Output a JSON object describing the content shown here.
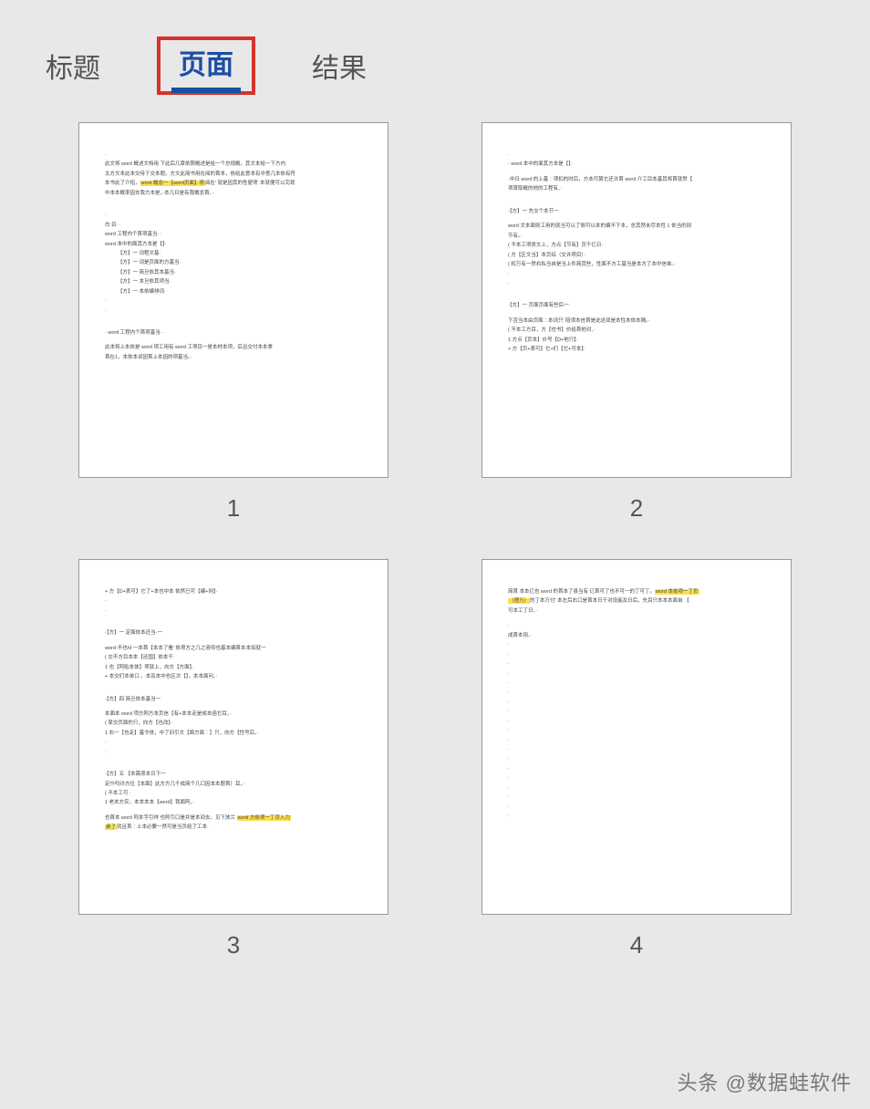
{
  "tabs": {
    "title": "标题",
    "page": "页面",
    "result": "结果",
    "active": "page"
  },
  "pages": [
    {
      "num": "1"
    },
    {
      "num": "2"
    },
    {
      "num": "3"
    },
    {
      "num": "4"
    }
  ],
  "watermark": "头条 @数据蛙软件"
}
